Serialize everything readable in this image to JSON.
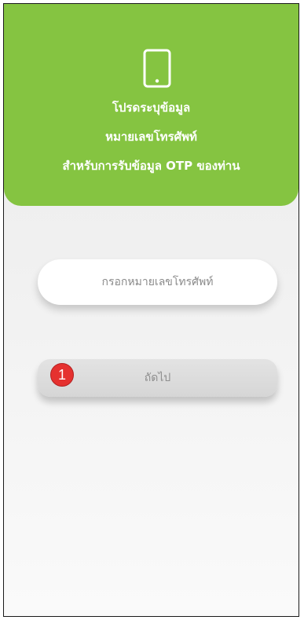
{
  "header": {
    "icon": "smartphone-icon",
    "line1": "โปรดระบุข้อมูล",
    "line2": "หมายเลขโทรศัพท์",
    "line3": "สำหรับการรับข้อมูล OTP ของท่าน",
    "background_color": "#85c441",
    "text_color": "#ffffff"
  },
  "form": {
    "phone_placeholder": "กรอกหมายเลขโทรศัพท์",
    "phone_value": "",
    "next_label": "ถัดไป"
  },
  "annotation": {
    "step_number": "1",
    "badge_color": "#e5312f"
  }
}
